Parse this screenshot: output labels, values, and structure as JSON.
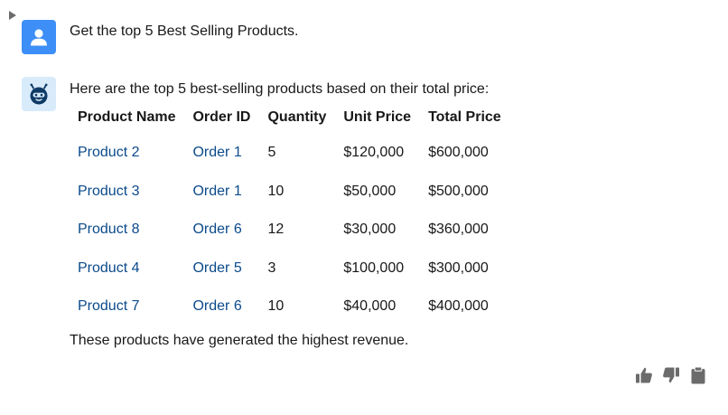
{
  "user_message": {
    "text": "Get the top 5 Best Selling Products."
  },
  "bot_message": {
    "intro": "Here are the top 5 best-selling products based on their total price:",
    "outro": "These products have generated the highest revenue."
  },
  "table": {
    "headers": [
      "Product Name",
      "Order ID",
      "Quantity",
      "Unit Price",
      "Total Price"
    ],
    "rows": [
      [
        "Product 2",
        "Order 1",
        "5",
        "$120,000",
        "$600,000"
      ],
      [
        "Product 3",
        "Order 1",
        "10",
        "$50,000",
        "$500,000"
      ],
      [
        "Product 8",
        "Order 6",
        "12",
        "$30,000",
        "$360,000"
      ],
      [
        "Product 4",
        "Order 5",
        "3",
        "$100,000",
        "$300,000"
      ],
      [
        "Product 7",
        "Order 6",
        "10",
        "$40,000",
        "$400,000"
      ]
    ]
  },
  "icons": {
    "user_avatar": "user-icon",
    "bot_avatar": "bot-icon",
    "like": "thumbs-up-icon",
    "dislike": "thumbs-down-icon",
    "copy": "clipboard-icon"
  },
  "colors": {
    "user_avatar_bg": "#3e8ef7",
    "bot_avatar_bg": "#d8ebfb",
    "link_text": "#0b4a8b",
    "action_icon": "#6b6b6b"
  }
}
